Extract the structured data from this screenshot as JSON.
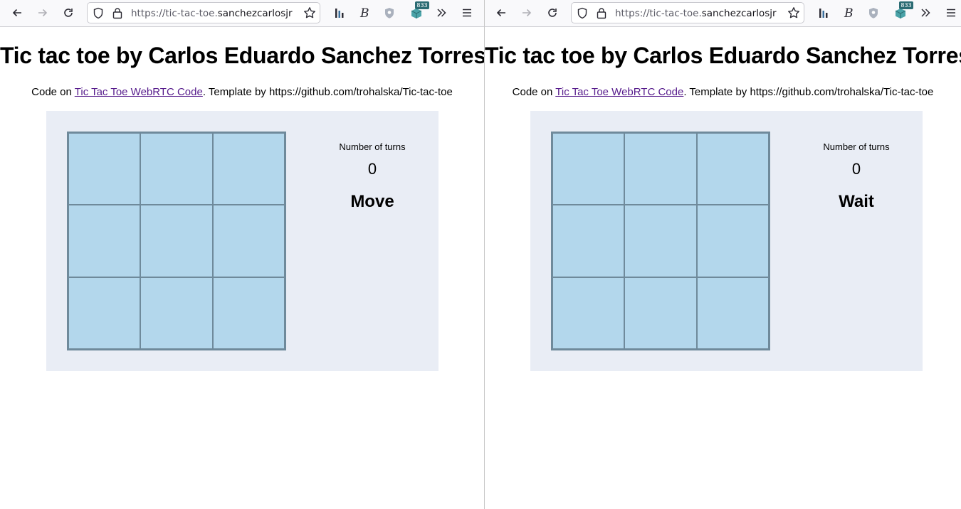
{
  "windows": [
    {
      "id": "left",
      "url_prefix": "https://tic-tac-toe.",
      "url_host": "sanchezcarlosjr",
      "extension_badge": "833",
      "page": {
        "title": "Tic tac toe by Carlos Eduardo Sanchez Torres",
        "code_prefix": "Code on ",
        "code_link": "Tic Tac Toe WebRTC Code",
        "template_text": ". Template by https://github.com/trohalska/Tic-tac-toe",
        "turns_label": "Number of turns",
        "turns_value": "0",
        "status": "Move",
        "cells": [
          "",
          "",
          "",
          "",
          "",
          "",
          "",
          "",
          ""
        ]
      }
    },
    {
      "id": "right",
      "url_prefix": "https://tic-tac-toe.",
      "url_host": "sanchezcarlosjr",
      "extension_badge": "833",
      "page": {
        "title": "Tic tac toe by Carlos Eduardo Sanchez Torres",
        "code_prefix": "Code on ",
        "code_link": "Tic Tac Toe WebRTC Code",
        "template_text": ". Template by https://github.com/trohalska/Tic-tac-toe",
        "turns_label": "Number of turns",
        "turns_value": "0",
        "status": "Wait",
        "cells": [
          "",
          "",
          "",
          "",
          "",
          "",
          "",
          "",
          ""
        ]
      }
    }
  ],
  "colors": {
    "board_fill": "#b3d7ec",
    "board_border": "#6f8a9b",
    "game_panel_bg": "#e9edf5",
    "visited_link": "#551a8b",
    "badge_bg": "#2b6b73"
  },
  "icons": [
    "back-arrow-icon",
    "forward-arrow-icon",
    "reload-icon",
    "tracking-shield-icon",
    "lock-icon",
    "bookmark-star-icon",
    "bar-chart-extension-icon",
    "script-b-extension-icon",
    "privacy-badge-extension-icon",
    "cube-extension-icon",
    "overflow-chevrons-icon",
    "hamburger-menu-icon"
  ]
}
